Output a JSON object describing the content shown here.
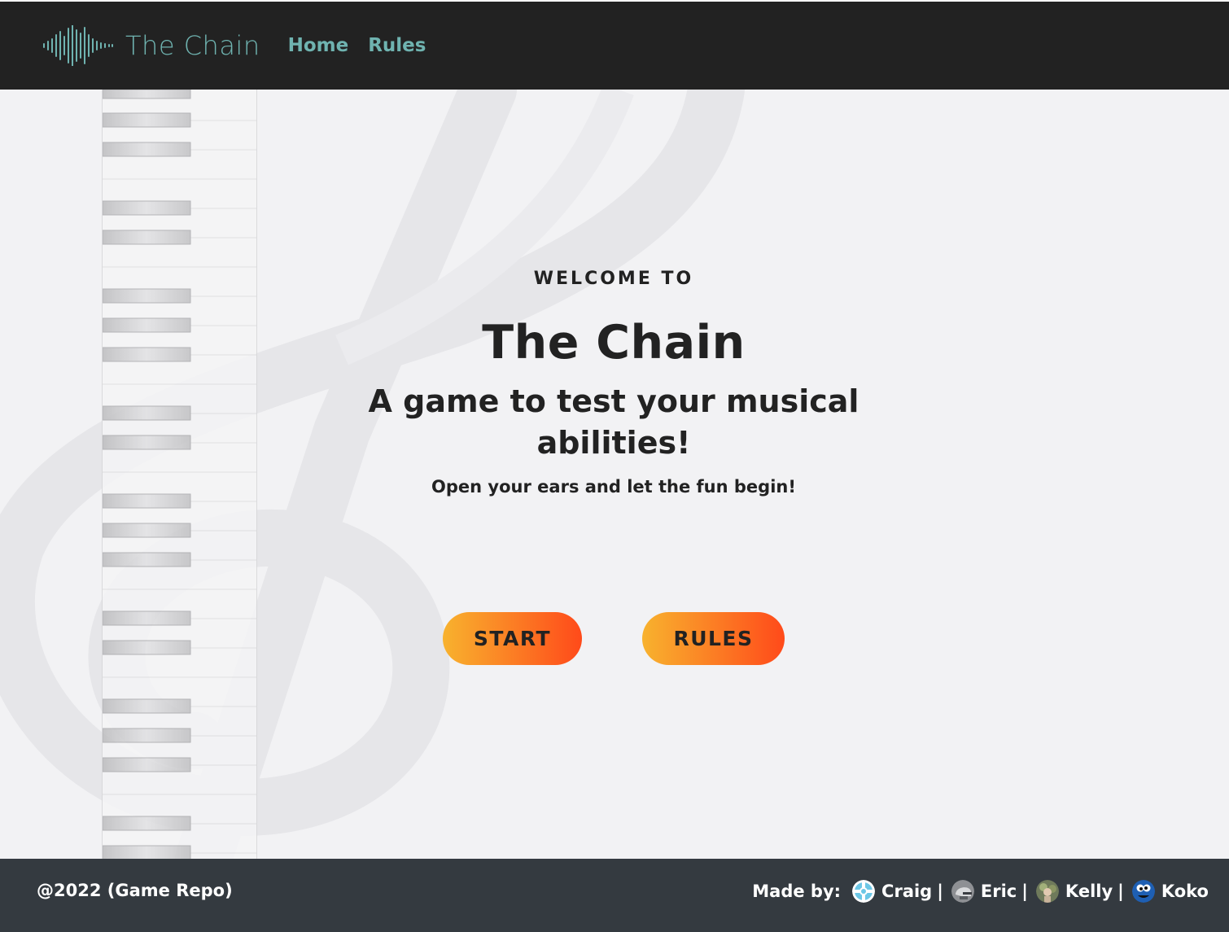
{
  "navbar": {
    "logo_text": "The Chain",
    "logo_icon": "sound-wave-icon",
    "links": [
      "Home",
      "Rules"
    ]
  },
  "hero": {
    "welcome": "WELCOME TO",
    "title": "The Chain",
    "subtitle": "A game to test your musical abilities!",
    "tagline": "Open your ears and let the fun begin!"
  },
  "buttons": {
    "start": "START",
    "rules": "RULES"
  },
  "footer": {
    "copyright": "@2022 (Game Repo)",
    "made_by": "Made by:",
    "separator": "|",
    "authors": [
      {
        "name": "Craig",
        "avatar": "life-ring-avatar"
      },
      {
        "name": "Eric",
        "avatar": "helmet-avatar"
      },
      {
        "name": "Kelly",
        "avatar": "photo-avatar"
      },
      {
        "name": "Koko",
        "avatar": "monster-avatar"
      }
    ]
  },
  "colors": {
    "navbar_bg": "#222222",
    "accent_teal": "#6fb3b0",
    "button_gradient_start": "#f8b22e",
    "button_gradient_end": "#ff4a1a",
    "footer_bg": "#343a40",
    "page_bg": "#f2f2f4"
  }
}
